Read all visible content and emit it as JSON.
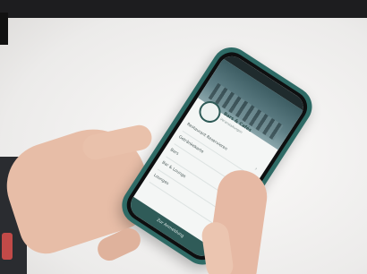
{
  "photo": {
    "top_overlay_text": "",
    "phone": {
      "body_color": "#2e6b66",
      "brand_title": "Bars & Cafés",
      "brand_subtitle": "Veranstaltungen",
      "menu_items": [
        {
          "label": "Restaurant Reservieren"
        },
        {
          "label": "Getränkekarte"
        },
        {
          "label": "Bars"
        },
        {
          "label": "Bar & Lounge"
        },
        {
          "label": "Lounges"
        }
      ],
      "bottom_button_label": "Zur Anmeldung"
    }
  }
}
